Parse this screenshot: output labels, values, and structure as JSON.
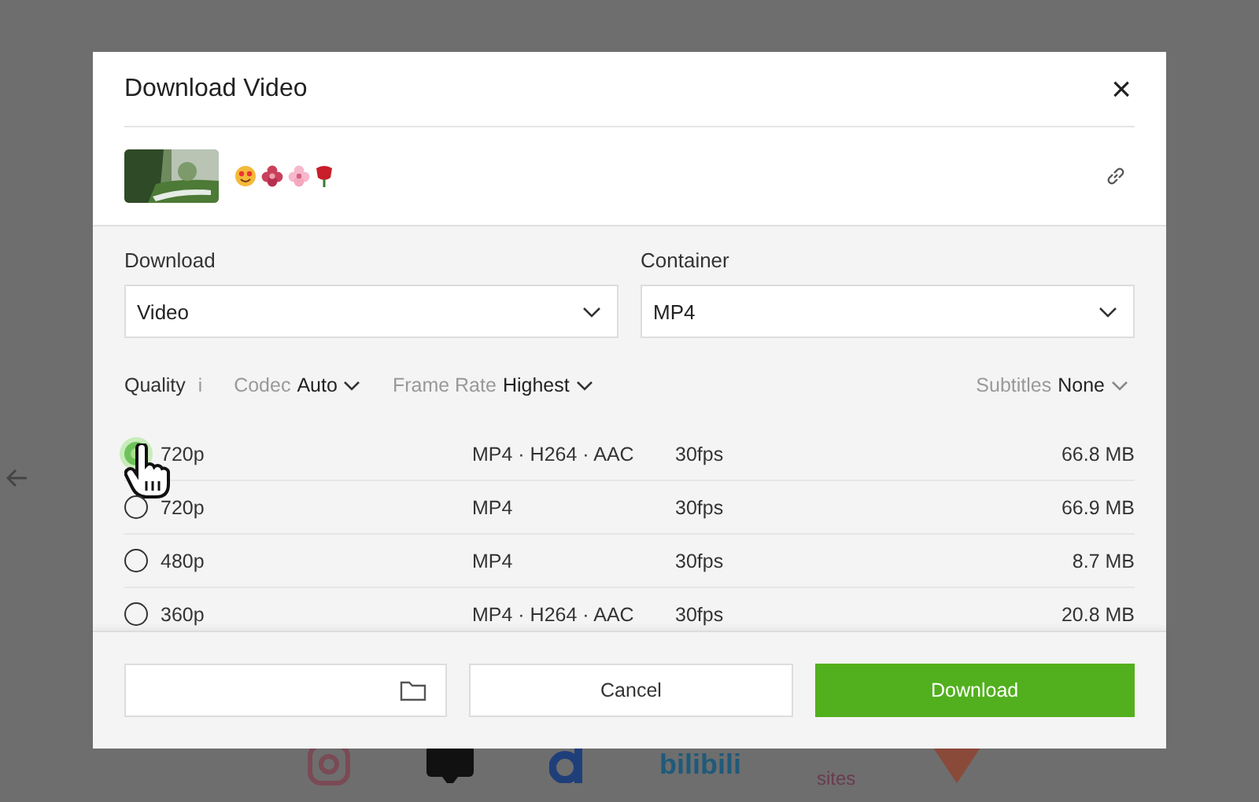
{
  "dialog": {
    "title": "Download Video",
    "close": "×"
  },
  "fields": [
    {
      "label": "Download",
      "value": "Video"
    },
    {
      "label": "Container",
      "value": "MP4"
    }
  ],
  "filters": [
    {
      "kind": "info",
      "label": "Quality",
      "value": "i"
    },
    {
      "kind": "dropdown",
      "label": "Codec",
      "value": "Auto"
    },
    {
      "kind": "dropdown",
      "label": "Frame Rate",
      "value": "Highest"
    },
    {
      "kind": "dropdown-right",
      "label": "Subtitles",
      "value": "None"
    }
  ],
  "formats": [
    {
      "quality": "720p",
      "format": "MP4 · H264 · AAC",
      "fps": "30fps",
      "size": "66.8 MB",
      "selected": true
    },
    {
      "quality": "720p",
      "format": "MP4",
      "fps": "30fps",
      "size": "66.9 MB",
      "selected": false
    },
    {
      "quality": "480p",
      "format": "MP4",
      "fps": "30fps",
      "size": "8.7 MB",
      "selected": false
    },
    {
      "quality": "360p",
      "format": "MP4 · H264 · AAC",
      "fps": "30fps",
      "size": "20.8 MB",
      "selected": false
    }
  ],
  "footer": {
    "cancel": "Cancel",
    "download": "Download"
  },
  "background": {
    "labels": [
      "bilibili",
      "sites"
    ]
  }
}
